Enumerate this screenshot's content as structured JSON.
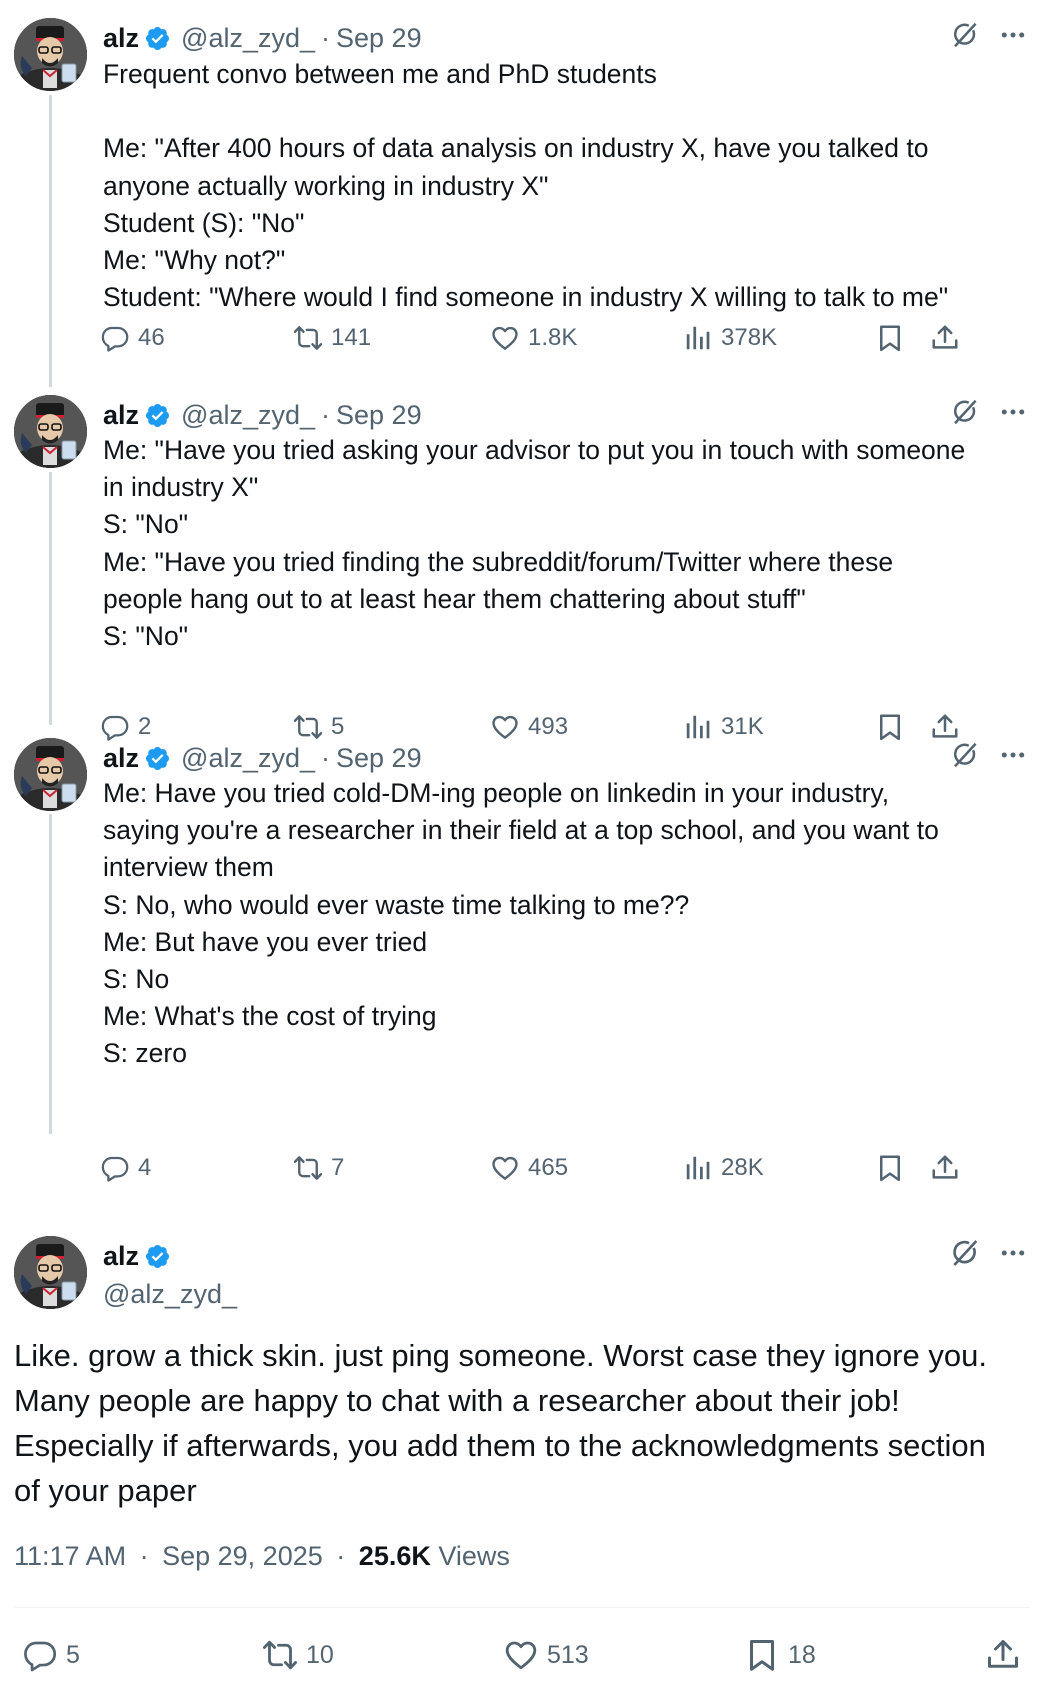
{
  "thread": [
    {
      "author": {
        "name": "alz",
        "handle": "@alz_zyd_",
        "verified": true
      },
      "separator": "·",
      "date": "Sep 29",
      "text": "Frequent convo between me and PhD students\n\nMe: \"After 400 hours of data analysis on industry X, have you talked to\nanyone actually working in industry X\"\nStudent (S): \"No\"\nMe: \"Why not?\"\nStudent: \"Where would I find someone in industry X willing to talk to me\"",
      "stats": {
        "replies": "46",
        "reposts": "141",
        "likes": "1.8K",
        "views": "378K"
      }
    },
    {
      "author": {
        "name": "alz",
        "handle": "@alz_zyd_",
        "verified": true
      },
      "separator": "·",
      "date": "Sep 29",
      "text": "Me: \"Have you tried asking your advisor to put you in touch with someone\nin industry X\"\nS: \"No\"\nMe: \"Have you tried finding the subreddit/forum/Twitter where these\npeople hang out to at least hear them chattering about stuff\"\nS: \"No\"",
      "stats": {
        "replies": "2",
        "reposts": "5",
        "likes": "493",
        "views": "31K"
      }
    },
    {
      "author": {
        "name": "alz",
        "handle": "@alz_zyd_",
        "verified": true
      },
      "separator": "·",
      "date": "Sep 29",
      "text": "Me: Have you tried cold-DM-ing people on linkedin in your industry,\nsaying you're a researcher in their field at a top school, and you want to\ninterview them\nS: No, who would ever waste time talking to me??\nMe: But have you ever tried\nS: No\nMe: What's the cost of trying\nS: zero",
      "stats": {
        "replies": "4",
        "reposts": "7",
        "likes": "465",
        "views": "28K"
      }
    }
  ],
  "main_post": {
    "author": {
      "name": "alz",
      "handle": "@alz_zyd_",
      "verified": true
    },
    "text": "Like. grow a thick skin. just ping someone. Worst case they ignore you.\nMany people are happy to chat with a researcher about their job!\nEspecially if afterwards, you add them to the acknowledgments section\nof your paper",
    "time": "11:17 AM",
    "date": "Sep 29, 2025",
    "separator": "·",
    "views_count": "25.6K",
    "views_label": "Views",
    "stats": {
      "replies": "5",
      "reposts": "10",
      "likes": "513",
      "bookmarks": "18"
    }
  },
  "icons": {
    "verified": "verified-badge-icon",
    "grok": "grok-icon",
    "more": "more-dots-icon",
    "reply": "reply-icon",
    "repost": "repost-icon",
    "like": "like-icon",
    "views": "views-icon",
    "bookmark": "bookmark-icon",
    "share": "share-icon"
  },
  "colors": {
    "text": "#0f1419",
    "secondary": "#536471",
    "verified": "#1d9bf0",
    "thread_line": "#cfd9de"
  }
}
